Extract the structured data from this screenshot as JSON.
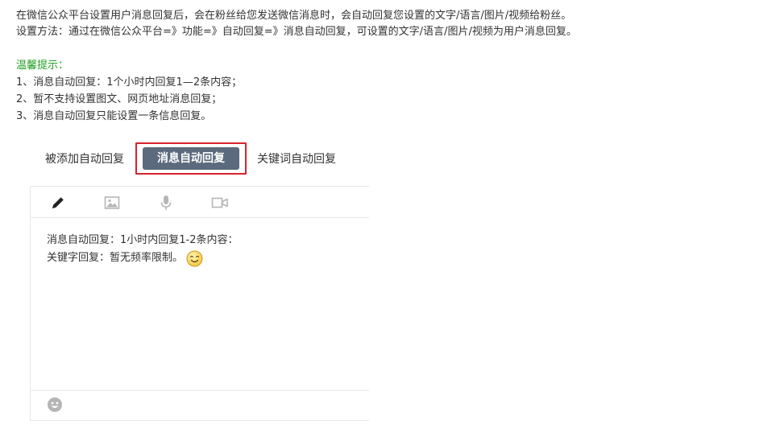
{
  "intro": {
    "line1": "在微信公众平台设置用户消息回复后，会在粉丝给您发送微信消息时，会自动回复您设置的文字/语言/图片/视频给粉丝。",
    "line2": "设置方法：通过在微信公众平台=》功能=》自动回复=》消息自动回复，可设置的文字/语言/图片/视频为用户消息回复。"
  },
  "tips": {
    "title": "温馨提示：",
    "items": [
      "1、消息自动回复：1个小时内回复1—2条内容；",
      "2、暂不支持设置图文、网页地址消息回复；",
      "3、消息自动回复只能设置一条信息回复。"
    ]
  },
  "tabs": {
    "added": "被添加自动回复",
    "message": "消息自动回复",
    "keyword": "关键词自动回复",
    "active": "message"
  },
  "editor": {
    "toolbar": [
      "pencil-icon",
      "image-icon",
      "microphone-icon",
      "video-camera-icon"
    ],
    "content_line1": "消息自动回复：1小时内回复1-2条内容：",
    "content_line2": "关键字回复：暂无频率限制。",
    "footer_icon": "emoji-icon"
  },
  "colors": {
    "tip_green": "#22a022",
    "active_tab_bg": "#5c6a7d",
    "highlight_border": "#d9232d",
    "icon_gray": "#b5b5b5"
  }
}
